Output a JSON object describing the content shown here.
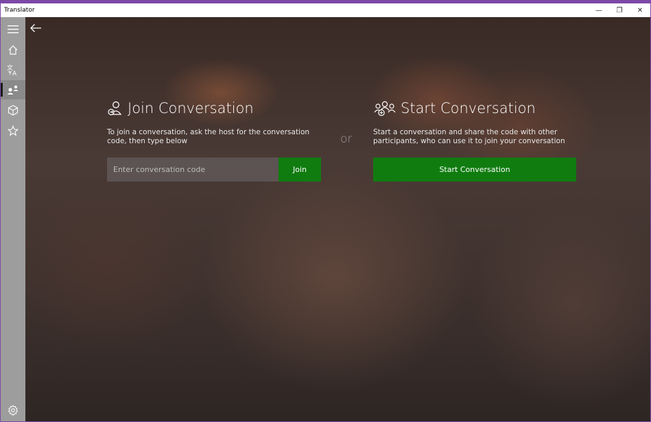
{
  "window": {
    "title": "Translator",
    "minimize_glyph": "—",
    "maximize_glyph": "❐",
    "close_glyph": "✕",
    "frame_color": "#7b4aa6"
  },
  "sidebar": {
    "items": [
      {
        "name": "hamburger-menu-icon"
      },
      {
        "name": "home-icon"
      },
      {
        "name": "translate-icon"
      },
      {
        "name": "conversation-icon",
        "selected": true
      },
      {
        "name": "phrasebook-icon"
      },
      {
        "name": "favorites-star-icon"
      }
    ],
    "settings": {
      "name": "settings-gear-icon"
    }
  },
  "main": {
    "back_icon": "back-arrow-icon",
    "join": {
      "icon": "join-person-icon",
      "title": "Join Conversation",
      "description_line1": "To join a conversation, ask the host for the conversation",
      "description_line2": "code, then type below",
      "input_placeholder": "Enter conversation code",
      "input_value": "",
      "button_label": "Join"
    },
    "or_label": "or",
    "start": {
      "icon": "start-group-icon",
      "title": "Start Conversation",
      "description_line1": "Start a conversation and share the code with other",
      "description_line2": "participants, who can use it to join your conversation",
      "button_label": "Start Conversation"
    }
  },
  "colors": {
    "accent_green": "#107c10",
    "sidebar_bg": "#9d9d9d",
    "titlebar_bg": "#ffffff"
  }
}
